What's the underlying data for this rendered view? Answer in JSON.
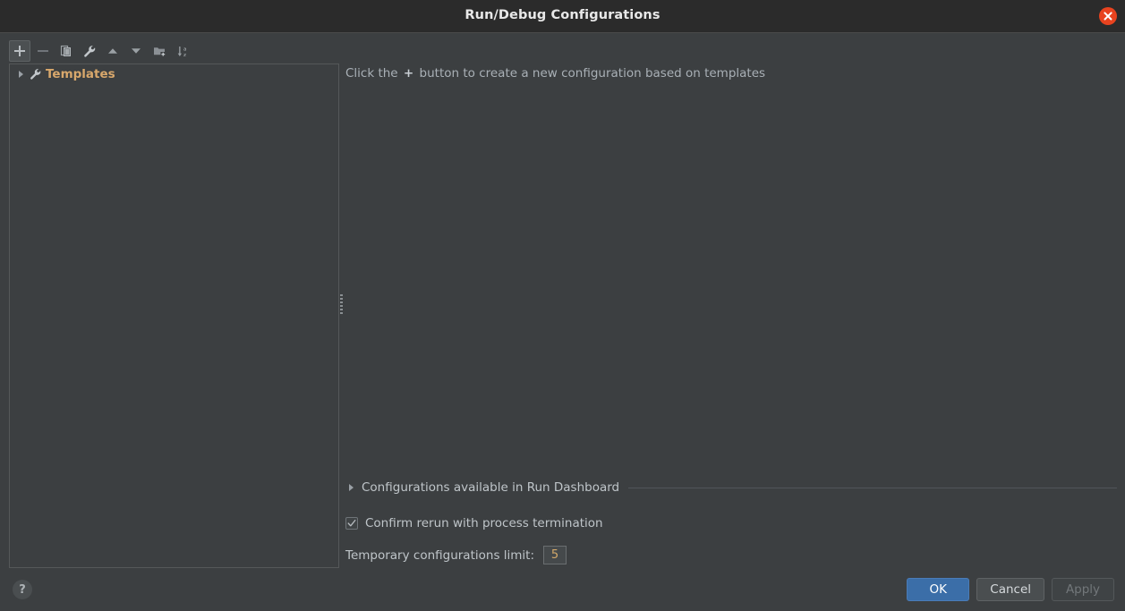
{
  "window": {
    "title": "Run/Debug Configurations",
    "close_icon": "close-icon"
  },
  "toolbar": {
    "items": [
      {
        "name": "add-configuration-button",
        "icon": "plus-icon",
        "label": "Add New Configuration",
        "state": "hover"
      },
      {
        "name": "remove-configuration-button",
        "icon": "minus-icon",
        "label": "Remove Configuration",
        "state": "disabled"
      },
      {
        "name": "copy-configuration-button",
        "icon": "copy-icon",
        "label": "Copy Configuration",
        "state": "normal"
      },
      {
        "name": "edit-templates-button",
        "icon": "wrench-icon",
        "label": "Edit Templates",
        "state": "normal"
      },
      {
        "name": "move-up-button",
        "icon": "arrow-up-icon",
        "label": "Move Up",
        "state": "normal"
      },
      {
        "name": "move-down-button",
        "icon": "arrow-down-icon",
        "label": "Move Down",
        "state": "normal"
      },
      {
        "name": "new-folder-button",
        "icon": "folder-add-icon",
        "label": "Create New Folder",
        "state": "normal"
      },
      {
        "name": "sort-configurations-button",
        "icon": "sort-az-icon",
        "label": "Sort Configurations",
        "state": "normal"
      }
    ]
  },
  "tree": {
    "items": [
      {
        "label": "Templates",
        "icon": "wrench-icon",
        "expanded": false,
        "arrow": "chevron-right-icon"
      }
    ]
  },
  "main": {
    "hint_prefix": "Click the",
    "hint_plus": "+",
    "hint_suffix": "button to create a new configuration based on templates"
  },
  "options": {
    "run_dashboard": {
      "label": "Configurations available in Run Dashboard",
      "expanded": false,
      "arrow": "chevron-right-icon"
    },
    "confirm_rerun": {
      "label": "Confirm rerun with process termination",
      "checked": true
    },
    "temp_limit": {
      "label": "Temporary configurations limit:",
      "value": "5"
    }
  },
  "footer": {
    "help_label": "?",
    "ok_label": "OK",
    "cancel_label": "Cancel",
    "apply_label": "Apply"
  },
  "colors": {
    "window_bg": "#3c3f41",
    "titlebar_bg": "#2b2b2b",
    "accent_blue": "#3b6ea8",
    "close_red": "#e8431f",
    "tree_label": "#d9a86c",
    "text": "#bfc5c9"
  }
}
